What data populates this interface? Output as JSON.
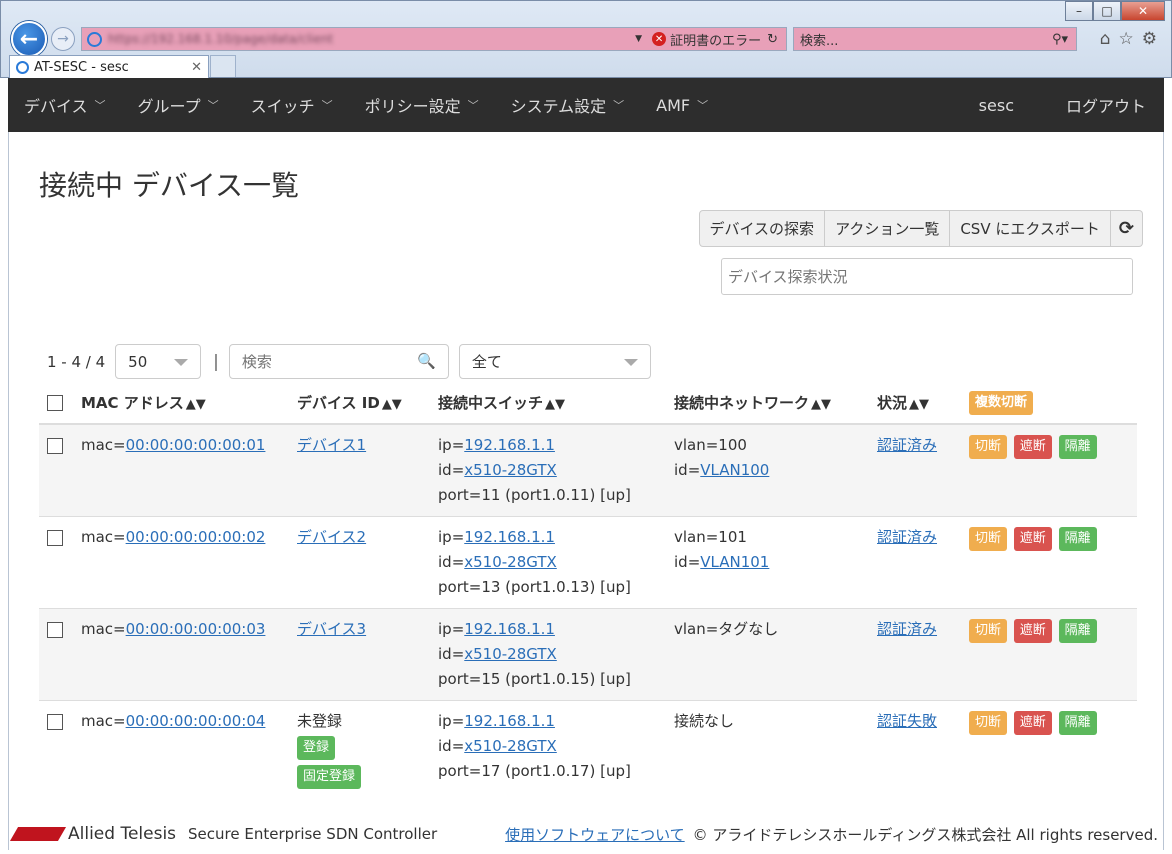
{
  "browser": {
    "url": "https://192.168.1.10/page/data/client",
    "cert_error": "証明書のエラー",
    "search_placeholder": "検索...",
    "tab_title": "AT-SESC - sesc"
  },
  "nav": {
    "items": [
      "デバイス",
      "グループ",
      "スイッチ",
      "ポリシー設定",
      "システム設定",
      "AMF"
    ],
    "user": "sesc",
    "logout": "ログアウト"
  },
  "page": {
    "title": "接続中 デバイス一覧",
    "buttons": {
      "discover": "デバイスの探索",
      "actions": "アクション一覧",
      "csv": "CSV にエクスポート"
    },
    "status_placeholder": "デバイス探索状況"
  },
  "toolbar": {
    "count": "1 - 4 / 4",
    "page_size": "50",
    "search_placeholder": "検索",
    "filter": "全て"
  },
  "table": {
    "headers": {
      "mac": "MAC アドレス",
      "device": "デバイス ID",
      "switch": "接続中スイッチ",
      "network": "接続中ネットワーク",
      "status": "状況",
      "bulk": "複数切断"
    },
    "action_labels": {
      "cut": "切断",
      "block": "遮断",
      "isolate": "隔離",
      "register": "登録",
      "fixed": "固定登録"
    },
    "rows": [
      {
        "mac_prefix": "mac=",
        "mac": "00:00:00:00:00:01",
        "device": "デバイス1",
        "ip_prefix": "ip=",
        "ip": "192.168.1.1",
        "id_prefix": "id=",
        "sw_id": "x510-28GTX",
        "port": "port=11 (port1.0.11) [up]",
        "vlan": "vlan=100",
        "net_id_prefix": "id=",
        "net_id": "VLAN100",
        "status": "認証済み"
      },
      {
        "mac_prefix": "mac=",
        "mac": "00:00:00:00:00:02",
        "device": "デバイス2",
        "ip_prefix": "ip=",
        "ip": "192.168.1.1",
        "id_prefix": "id=",
        "sw_id": "x510-28GTX",
        "port": "port=13 (port1.0.13) [up]",
        "vlan": "vlan=101",
        "net_id_prefix": "id=",
        "net_id": "VLAN101",
        "status": "認証済み"
      },
      {
        "mac_prefix": "mac=",
        "mac": "00:00:00:00:00:03",
        "device": "デバイス3",
        "ip_prefix": "ip=",
        "ip": "192.168.1.1",
        "id_prefix": "id=",
        "sw_id": "x510-28GTX",
        "port": "port=15 (port1.0.15) [up]",
        "vlan": "vlan=タグなし",
        "status": "認証済み"
      },
      {
        "mac_prefix": "mac=",
        "mac": "00:00:00:00:00:04",
        "device_unregistered": "未登録",
        "ip_prefix": "ip=",
        "ip": "192.168.1.1",
        "id_prefix": "id=",
        "sw_id": "x510-28GTX",
        "port": "port=17 (port1.0.17) [up]",
        "network_none": "接続なし",
        "status": "認証失敗"
      }
    ]
  },
  "footer": {
    "logo": "Allied Telesis",
    "product": "Secure Enterprise SDN Controller",
    "about_link": "使用ソフトウェアについて",
    "copyright": "© アライドテレシスホールディングス株式会社 All rights reserved."
  },
  "colors": {
    "navbar": "#2d2d2d",
    "link": "#2a6eb8",
    "warn": "#f0ad4e",
    "danger": "#d9534f",
    "success": "#5cb85c",
    "logo": "#c0141e"
  }
}
